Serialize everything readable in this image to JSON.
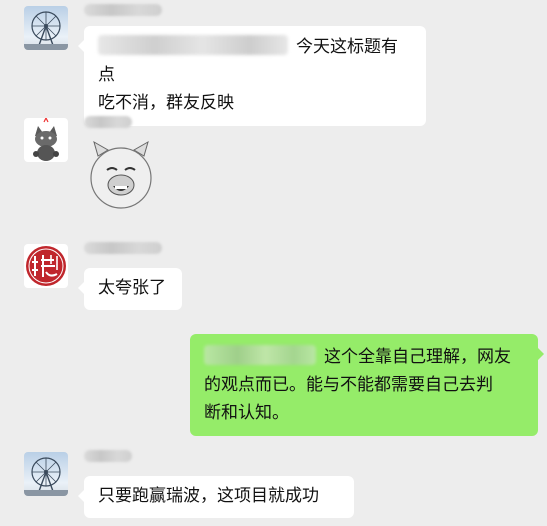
{
  "messages": [
    {
      "id": 1,
      "direction": "incoming",
      "avatar": "ferris-wheel-avatar",
      "text": "今天这标题有点\n吃不消，群友反映",
      "sender_name_blurred": true,
      "content_partially_blurred": true
    },
    {
      "id": 2,
      "direction": "incoming",
      "avatar": "cat-sticker-avatar",
      "sticker": "pig-face-sticker",
      "sender_name_blurred": true
    },
    {
      "id": 3,
      "direction": "incoming",
      "avatar": "red-seal-avatar",
      "text": "太夸张了",
      "sender_name_blurred": true
    },
    {
      "id": 4,
      "direction": "outgoing",
      "text": "这个全靠自己理解，网友\n的观点而已。能与不能都需要自己去判\n断和认知。",
      "content_partially_blurred": true
    },
    {
      "id": 5,
      "direction": "incoming",
      "avatar": "ferris-wheel-avatar",
      "text": "只要跑赢瑞波，这项目就成功",
      "sender_name_blurred": true
    }
  ],
  "colors": {
    "background": "#ededed",
    "incoming_bubble": "#ffffff",
    "outgoing_bubble": "#95ec69",
    "seal_red": "#c0262c"
  }
}
